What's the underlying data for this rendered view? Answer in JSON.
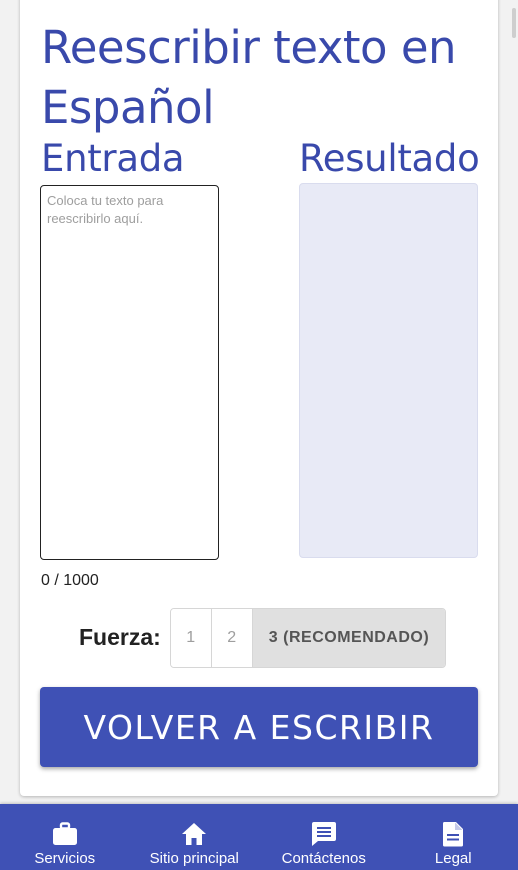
{
  "page": {
    "title": "Reescribir texto en Español",
    "input_label": "Entrada",
    "output_label": "Resultado"
  },
  "input": {
    "value": "",
    "placeholder": "Coloca tu texto para reescribirlo aquí."
  },
  "counter": "0 / 1000",
  "strength": {
    "label": "Fuerza:",
    "options": [
      "1",
      "2",
      "3 (RECOMENDADO)"
    ],
    "selected": "3 (RECOMENDADO)"
  },
  "action_button": "VOLVER A ESCRIBIR",
  "nav": {
    "items": [
      {
        "label": "Servicios",
        "icon": "briefcase-icon"
      },
      {
        "label": "Sitio principal",
        "icon": "home-icon"
      },
      {
        "label": "Contáctenos",
        "icon": "message-icon"
      },
      {
        "label": "Legal",
        "icon": "document-icon"
      }
    ]
  },
  "colors": {
    "accent": "#3f51b5",
    "title": "#3949ab",
    "result_bg": "#e8eaf6",
    "selected_toggle": "#e0e0e0"
  }
}
